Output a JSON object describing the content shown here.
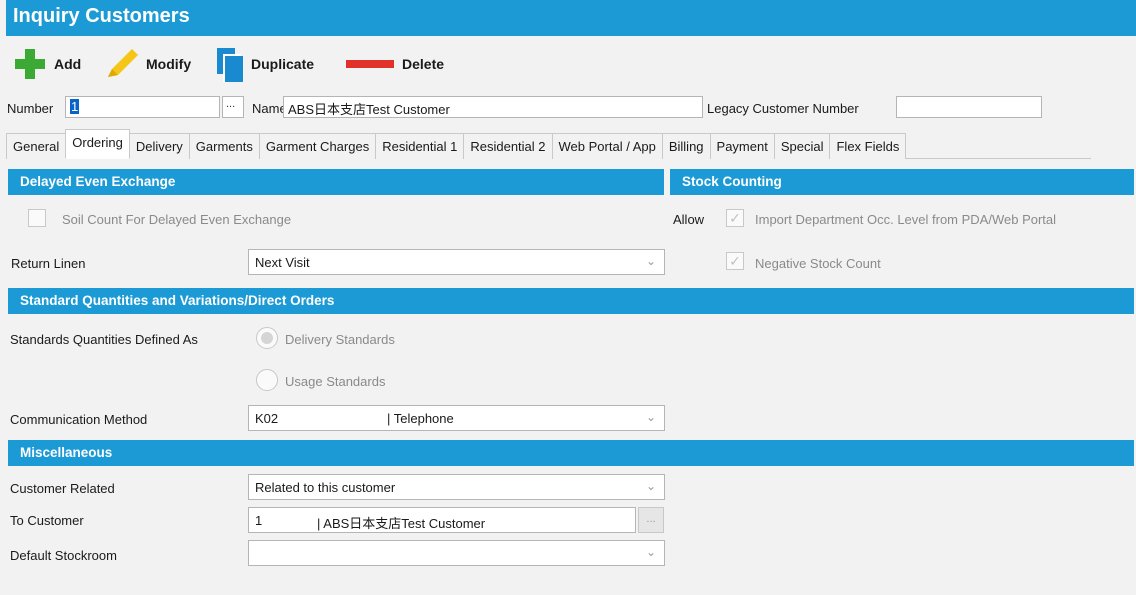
{
  "window": {
    "title": "Inquiry Customers"
  },
  "toolbar": {
    "add": "Add",
    "modify": "Modify",
    "duplicate": "Duplicate",
    "delete": "Delete"
  },
  "header": {
    "number_label": "Number",
    "number_value": "1",
    "browse_label": "...",
    "name_label": "Name",
    "name_value": "ABS日本支店Test Customer",
    "legacy_label": "Legacy Customer Number",
    "legacy_value": ""
  },
  "tabs": [
    {
      "label": "General"
    },
    {
      "label": "Ordering",
      "active": true
    },
    {
      "label": "Delivery"
    },
    {
      "label": "Garments"
    },
    {
      "label": "Garment Charges"
    },
    {
      "label": "Residential 1"
    },
    {
      "label": "Residential 2"
    },
    {
      "label": "Web Portal / App"
    },
    {
      "label": "Billing"
    },
    {
      "label": "Payment"
    },
    {
      "label": "Special"
    },
    {
      "label": "Flex Fields"
    }
  ],
  "delayed": {
    "title": "Delayed Even Exchange",
    "soil_count_label": "Soil Count For Delayed Even Exchange",
    "soil_count_checked": false,
    "return_linen_label": "Return Linen",
    "return_linen_value": "Next Visit"
  },
  "stock": {
    "title": "Stock Counting",
    "allow_label": "Allow",
    "import_label": "Import Department Occ. Level from PDA/Web Portal",
    "import_checked": true,
    "negative_label": "Negative Stock Count",
    "negative_checked": true
  },
  "standard": {
    "title": "Standard Quantities and Variations/Direct Orders",
    "defined_as_label": "Standards Quantities Defined As",
    "option_delivery": "Delivery Standards",
    "option_usage": "Usage Standards",
    "selected": "Delivery Standards",
    "comm_label": "Communication Method",
    "comm_code": "K02",
    "comm_desc": "| Telephone"
  },
  "misc": {
    "title": "Miscellaneous",
    "customer_related_label": "Customer Related",
    "customer_related_value": "Related to this customer",
    "to_customer_label": "To Customer",
    "to_customer_code": "1",
    "to_customer_name": "| ABS日本支店Test Customer",
    "to_customer_browse": "...",
    "stockroom_label": "Default Stockroom",
    "stockroom_value": ""
  },
  "colors": {
    "accent": "#1c9ad6",
    "add_green": "#3aaa35",
    "modify_yellow": "#f5c518",
    "duplicate_blue": "#1a8ad0",
    "delete_red": "#e0312b"
  },
  "icons": {
    "chevron": "chevron-down-icon",
    "check": "checkmark-icon"
  }
}
